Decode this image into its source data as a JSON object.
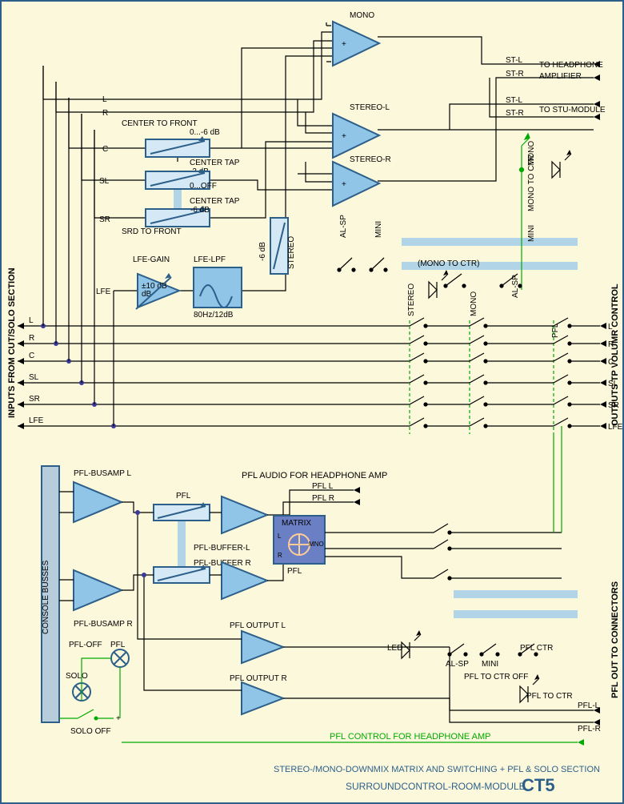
{
  "title": {
    "line1": "STEREO-/MONO-DOWNMIX MATRIX AND SWITCHING + PFL & SOLO SECTION",
    "line2": "SURROUNDCONTROL-ROOM-MODULE",
    "code": "CT5"
  },
  "left_inputs_top": {
    "L": "L",
    "R": "R",
    "C": "C",
    "SL": "SL",
    "SR": "SR",
    "LFE": "LFE"
  },
  "left_inputs_main": {
    "L": "L",
    "R": "R",
    "C": "C",
    "SL": "SL",
    "SR": "SR",
    "LFE": "LFE"
  },
  "left_side_label": "INPUTS FROM CUT/SOLO SECTION",
  "right_side_top1": "TO HEADPHONE",
  "right_side_top1b": "AMPLIFIER",
  "right_side_top2": "TO STU-MODULE",
  "right_outputs_top": {
    "STL": "ST-L",
    "STR": "ST-R",
    "STL2": "ST-L",
    "STR2": "ST-R"
  },
  "right_side_mid": "OUTPUTS TP VOLUMR CONTROL",
  "right_outputs_mid": {
    "L": "L",
    "R": "R",
    "C": "C",
    "SL": "SL",
    "SR": "SR",
    "LFE": "LFE"
  },
  "right_side_bot": "PFL OUT TO CONNECTORS",
  "right_outputs_bot": {
    "PFLL": "PFL-L",
    "PFLR": "PFL-R"
  },
  "amps": {
    "mono": "MONO",
    "stereoL": "STEREO-L",
    "stereoR": "STEREO-R",
    "lfegain": "LFE-GAIN",
    "lfegain_val": "±10 dB",
    "lfelpf": "LFE-LPF",
    "lfelpf_sub": "80Hz/12dB"
  },
  "attens": {
    "ctf": "CENTER TO FRONT",
    "ctf_range": "0...-6 dB",
    "ctf_tap": "CENTER TAP",
    "ctf_db": "-3 dB",
    "srdf": "SRD TO FRONT",
    "srdf_range": "0...OFF",
    "srdf_tap": "CENTER TAP",
    "srdf_db": "-6 dB",
    "stereo6": "-6 dB",
    "stereo_lbl": "STEREO"
  },
  "sw_top": {
    "alsp": "AL-SP",
    "mini": "MINI",
    "monoctr": "(MONO TO CTR)",
    "stereo": "STEREO",
    "mono": "MONO",
    "mono2": "MONO",
    "mono_to_ctr": "MONO TO CTR",
    "mini2": "MINI",
    "alsp2": "AL-SP"
  },
  "pfl": {
    "busL": "PFL-BUSAMP L",
    "busR": "PFL-BUSAMP R",
    "pfl": "PFL",
    "bufL": "PFL-BUFFER-L",
    "bufR": "PFL-BUFFER R",
    "matrix": "MATRIX",
    "mL": "L",
    "mR": "R",
    "mMNO": "MNO",
    "mPFL": "PFL",
    "hp": "PFL AUDIO FOR HEADPHONE AMP",
    "pflL": "PFL L",
    "pflR": "PFL R",
    "outL": "PFL OUTPUT L",
    "outR": "PFL OUTPUT R",
    "solo": "SOLO",
    "pfloff": "PFL-OFF",
    "solooff": "SOLO OFF",
    "led": "LED",
    "alsp": "AL-SP",
    "mini": "MINI",
    "pflctr": "PFL CTR",
    "pfl2ctroff": "PFL TO CTR OFF",
    "pfl2ctr": "PFL TO CTR",
    "ctrl": "PFL CONTROL FOR HEADPHONE AMP",
    "consolebus": "CONSOLE BUSSES",
    "pfl2": "PFL"
  },
  "chart_data": null
}
